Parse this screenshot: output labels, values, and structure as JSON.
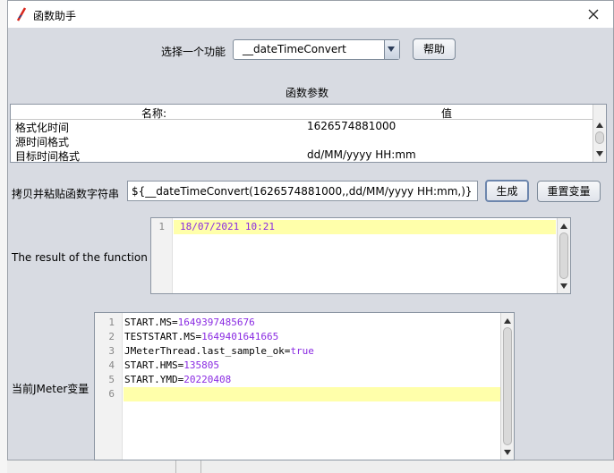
{
  "window": {
    "title": "函数助手"
  },
  "function_select": {
    "label": "选择一个功能",
    "selected": "__dateTimeConvert",
    "help_button": "帮助"
  },
  "params": {
    "section_title": "函数参数",
    "col_name": "名称:",
    "col_value": "值",
    "rows": [
      {
        "name": "格式化时间",
        "value": "1626574881000"
      },
      {
        "name": "源时间格式",
        "value": ""
      },
      {
        "name": "目标时间格式",
        "value": "dd/MM/yyyy HH:mm"
      }
    ]
  },
  "copy": {
    "label": "拷贝并粘贴函数字符串",
    "value": "${__dateTimeConvert(1626574881000,,dd/MM/yyyy HH:mm,)}",
    "generate_button": "生成",
    "reset_button": "重置变量"
  },
  "result": {
    "label": "The result of the function is",
    "lines": [
      {
        "num": "1",
        "text": "18/07/2021 10:21"
      }
    ]
  },
  "jmeter_vars": {
    "label": "当前JMeter变量",
    "lines": [
      {
        "num": "1",
        "key": "START.MS=",
        "val": "1649397485676"
      },
      {
        "num": "2",
        "key": "TESTSTART.MS=",
        "val": "1649401641665"
      },
      {
        "num": "3",
        "key": "JMeterThread.last_sample_ok=",
        "val": "true"
      },
      {
        "num": "4",
        "key": "START.HMS=",
        "val": "135805"
      },
      {
        "num": "5",
        "key": "START.YMD=",
        "val": "20220408"
      },
      {
        "num": "6",
        "key": "",
        "val": ""
      }
    ]
  },
  "colors": {
    "dialog_bg": "#d8dbe2",
    "highlight": "#ffffaa",
    "value_purple": "#8a2be2"
  }
}
